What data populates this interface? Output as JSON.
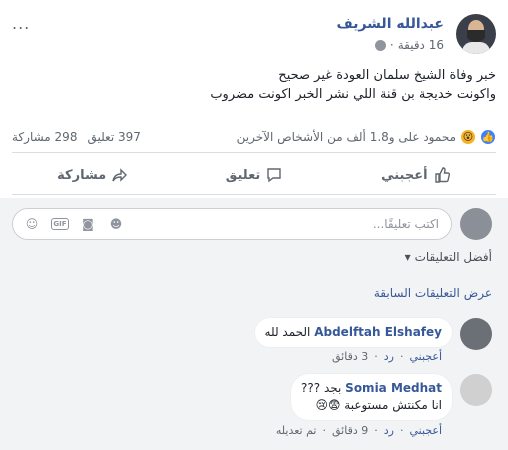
{
  "post": {
    "author": "عبدالله الشريف",
    "time": "16 دقيقة",
    "more": "...",
    "text_line1": "خبر وفاة الشيخ سلمان العودة غير صحيح",
    "text_line2": "واكونت خديجة بن قنة اللي نشر الخبر اكونت مضروب",
    "reactions_text": "محمود على و1.8 ألف من الأشخاص الآخرين",
    "comments_count": "397 تعليق",
    "shares_count": "298 مشاركة"
  },
  "actions": {
    "like": "أعجبني",
    "comment": "تعليق",
    "share": "مشاركة"
  },
  "composer": {
    "placeholder": "اكتب تعليقًا..."
  },
  "filters": {
    "top_comments": "أفضل التعليقات",
    "view_previous": "عرض التعليقات السابقة"
  },
  "comments": [
    {
      "name": "Abdelftah Elshafey",
      "text": "الحمد لله",
      "like": "أعجبني",
      "reply": "رد",
      "time": "3 دقائق"
    },
    {
      "name": "Somia Medhat",
      "text_line1": "بجد ???",
      "text_line2": "انا مكنتش مستوعبة 😨😢",
      "like": "أعجبني",
      "reply": "رد",
      "time": "9 دقائق",
      "edited": "تم تعديله"
    }
  ],
  "colors": {
    "link": "#365899",
    "like_reaction": "#4080ff",
    "haha_reaction": "#f7b125"
  }
}
